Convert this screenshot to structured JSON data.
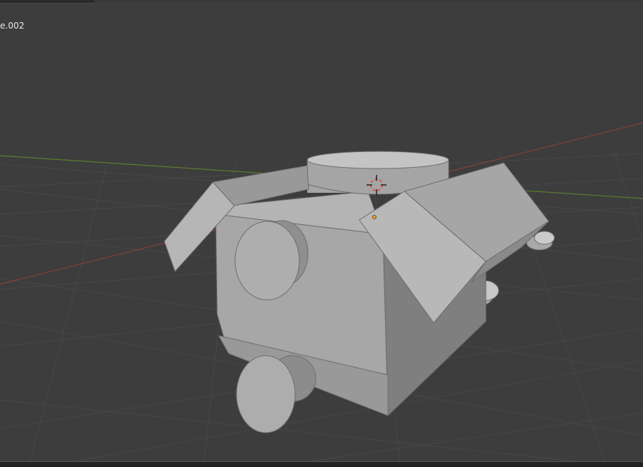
{
  "viewport": {
    "object_name": "e.002"
  },
  "colors": {
    "background": "#3d3d3d",
    "grid_line": "#474747",
    "x_axis": "#8a3d3d",
    "y_axis": "#5d7d2e",
    "mesh_light": "#b3b3b3",
    "mesh_mid": "#a2a2a2",
    "mesh_dark": "#7d7d7d",
    "origin_point": "#e69a28",
    "cursor_red": "#e05050"
  },
  "icons": {
    "cursor": "3d-cursor-icon",
    "origin": "object-origin-icon"
  }
}
